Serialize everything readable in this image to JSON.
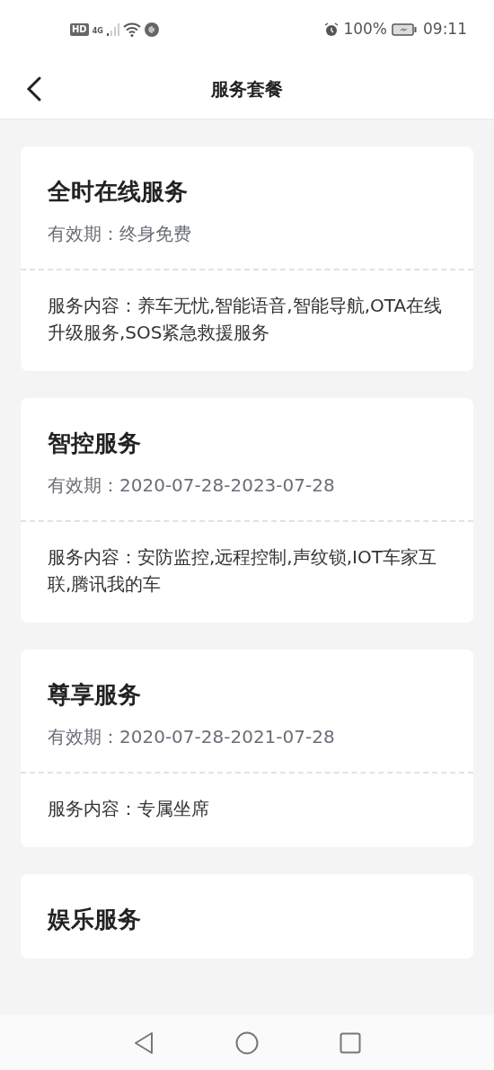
{
  "status_bar": {
    "hd": "HD",
    "network": "4G",
    "battery": "100%",
    "time": "09:11"
  },
  "header": {
    "title": "服务套餐"
  },
  "packages": [
    {
      "title": "全时在线服务",
      "validity": "有效期：终身免费",
      "content": "服务内容：养车无忧,智能语音,智能导航,OTA在线升级服务,SOS紧急救援服务"
    },
    {
      "title": "智控服务",
      "validity": "有效期：2020-07-28-2023-07-28",
      "content": "服务内容：安防监控,远程控制,声纹锁,IOT车家互联,腾讯我的车"
    },
    {
      "title": "尊享服务",
      "validity": "有效期：2020-07-28-2021-07-28",
      "content": "服务内容：专属坐席"
    },
    {
      "title": "娱乐服务"
    }
  ]
}
